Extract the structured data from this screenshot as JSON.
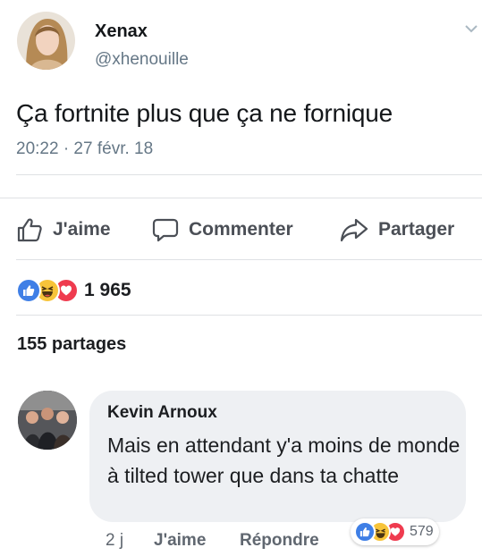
{
  "tweet": {
    "author_name": "Xenax",
    "author_handle": "@xhenouille",
    "text": "Ça fortnite plus que ça ne fornique",
    "timestamp": "20:22 · 27 févr. 18"
  },
  "actions": {
    "like_label": "J'aime",
    "comment_label": "Commenter",
    "share_label": "Partager"
  },
  "reactions": {
    "count": "1 965",
    "types": [
      "like-icon",
      "haha-icon",
      "love-icon"
    ]
  },
  "shares_label": "155 partages",
  "comment": {
    "author": "Kevin Arnoux",
    "text": "Mais en attendant y'a moins de monde à tilted tower que dans ta chatte",
    "time": "2 j",
    "like_label": "J'aime",
    "reply_label": "Répondre",
    "reaction_count": "579"
  },
  "colors": {
    "like_blue": "#3f7fe6",
    "haha_yellow": "#f7c43a",
    "love_red": "#ef3b4f",
    "bubble_grey": "#eef0f3",
    "action_grey": "#4b4f56"
  }
}
